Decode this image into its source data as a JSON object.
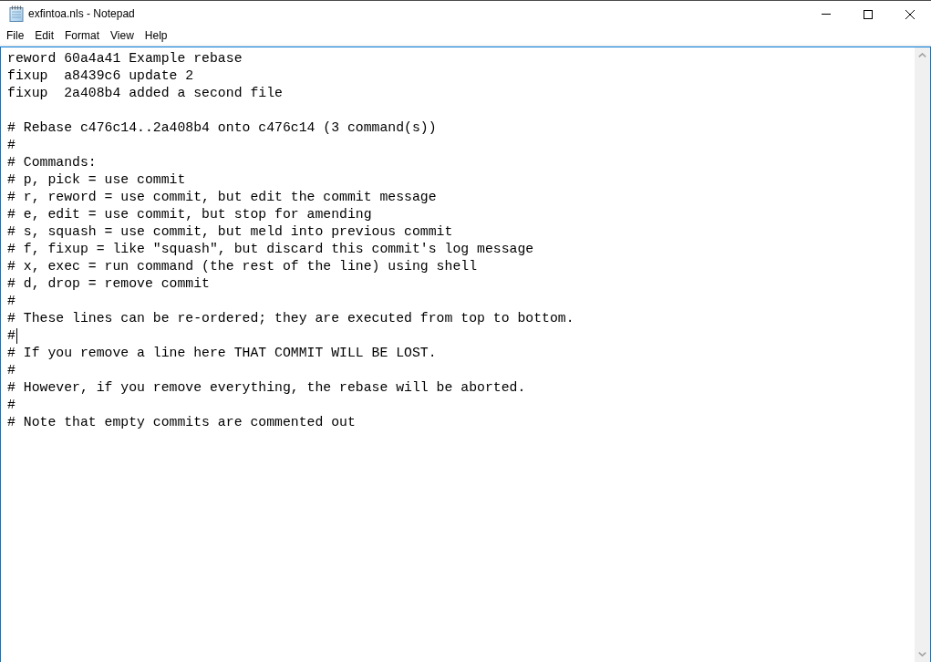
{
  "window": {
    "title": "exfintoa.nls - Notepad"
  },
  "menu_bar": [
    "File",
    "Edit",
    "Format",
    "View",
    "Help"
  ],
  "editor": {
    "focused": true,
    "blocks": [
      {
        "lines": [
          {
            "text": "reword 60a4a41 Example rebase",
            "caret": false
          },
          {
            "text": "fixup  a8439c6 update 2",
            "caret": false
          },
          {
            "text": "fixup  2a408b4 added a second file",
            "caret": false
          }
        ]
      },
      {
        "lines": [
          {
            "text": "# Rebase c476c14..2a408b4 onto c476c14 (3 command(s))",
            "caret": false
          },
          {
            "text": "#",
            "caret": false
          },
          {
            "text": "# Commands:",
            "caret": false
          },
          {
            "text": "# p, pick = use commit",
            "caret": false
          },
          {
            "text": "# r, reword = use commit, but edit the commit message",
            "caret": false
          },
          {
            "text": "# e, edit = use commit, but stop for amending",
            "caret": false
          },
          {
            "text": "# s, squash = use commit, but meld into previous commit",
            "caret": false
          },
          {
            "text": "# f, fixup = like \"squash\", but discard this commit's log message",
            "caret": false
          },
          {
            "text": "# x, exec = run command (the rest of the line) using shell",
            "caret": false
          },
          {
            "text": "# d, drop = remove commit",
            "caret": false
          },
          {
            "text": "#",
            "caret": false
          },
          {
            "text": "# These lines can be re-ordered; they are executed from top to bottom.",
            "caret": false
          },
          {
            "text": "#",
            "caret": true
          },
          {
            "text": "# If you remove a line here THAT COMMIT WILL BE LOST.",
            "caret": false
          },
          {
            "text": "#",
            "caret": false
          },
          {
            "text": "# However, if you remove everything, the rebase will be aborted.",
            "caret": false
          },
          {
            "text": "#",
            "caret": false
          },
          {
            "text": "# Note that empty commits are commented out",
            "caret": false
          }
        ]
      }
    ]
  }
}
